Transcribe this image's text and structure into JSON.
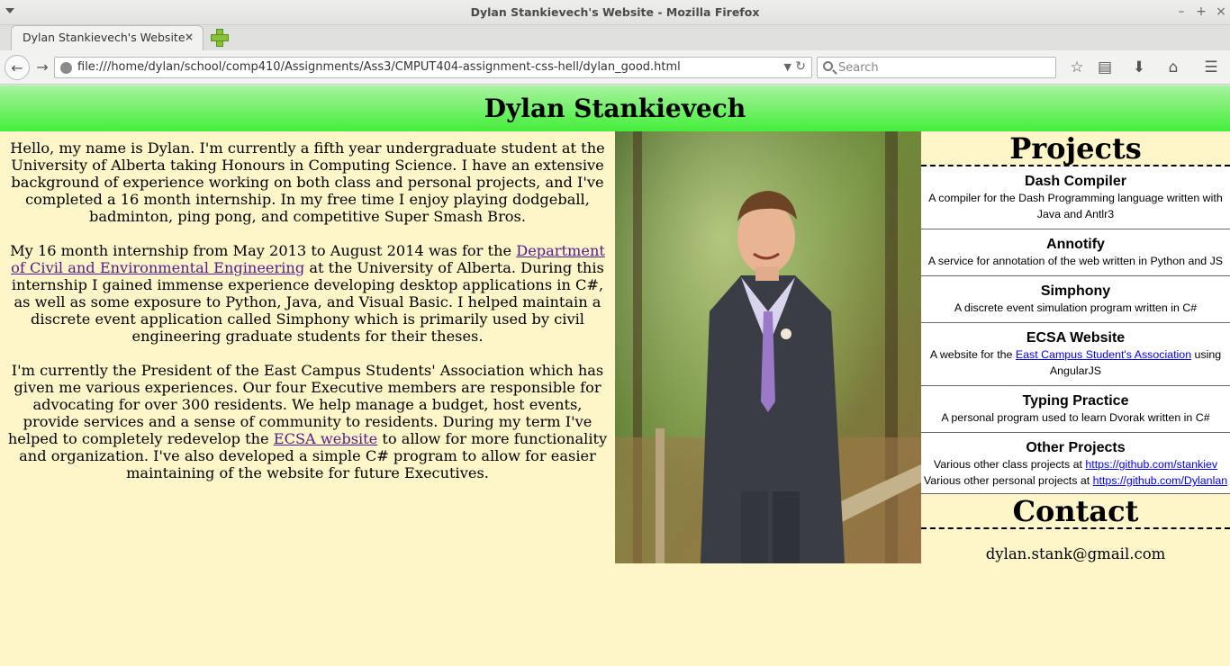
{
  "window": {
    "title": "Dylan Stankievech's Website - Mozilla Firefox",
    "controls": [
      "–",
      "+",
      "×"
    ]
  },
  "tab": {
    "label": "Dylan Stankievech's Website",
    "close": "×"
  },
  "nav": {
    "url": "file:///home/dylan/school/comp410/Assignments/Ass3/CMPUT404-assignment-css-hell/dylan_good.html",
    "search_placeholder": "Search"
  },
  "page": {
    "heading": "Dylan Stankievech",
    "bio": {
      "p1": "Hello, my name is Dylan. I'm currently a fifth year undergraduate student at the University of Alberta taking Honours in Computing Science. I have an extensive background of experience working on both class and personal projects, and I've completed a 16 month internship. In my free time I enjoy playing dodgeball, badminton, ping pong, and competitive Super Smash Bros.",
      "p2_before": "My 16 month internship from May 2013 to August 2014 was for the ",
      "p2_link": "Department of Civil and Environmental Engineering",
      "p2_after": " at the University of Alberta. During this internship I gained immense experience developing desktop applications in C#, as well as some exposure to Python, Java, and Visual Basic. I helped maintain a discrete event application called Simphony which is primarily used by civil engineering graduate students for their theses.",
      "p3_before": "I'm currently the President of the East Campus Students' Association which has given me various experiences. Our four Executive members are responsible for advocating for over 300 residents. We help manage a budget, host events, provide services and a sense of community to residents. During my term I've helped to completely redevelop the ",
      "p3_link": "ECSA website",
      "p3_after": " to allow for more functionality and organization. I've also developed a simple C# program to allow for easier maintaining of the website for future Executives."
    },
    "projects_heading": "Projects",
    "projects": [
      {
        "title": "Dash Compiler",
        "desc": "A compiler for the Dash Programming language written with Java and Antlr3"
      },
      {
        "title": "Annotify",
        "desc": "A service for annotation of the web written in Python and JS"
      },
      {
        "title": "Simphony",
        "desc": "A discrete event simulation program written in C#"
      },
      {
        "title": "ECSA Website",
        "desc_before": "A website for the ",
        "desc_link": "East Campus Student's Association",
        "desc_after": " using AngularJS"
      },
      {
        "title": "Typing Practice",
        "desc": "A personal program used to learn Dvorak written in C#"
      },
      {
        "title": "Other Projects",
        "line1_before": "Various other class projects at ",
        "line1_link": "https://github.com/stankiev",
        "line2_before": "Various other personal projects at ",
        "line2_link": "https://github.com/Dylanlan"
      }
    ],
    "contact_heading": "Contact",
    "email": "dylan.stank@gmail.com"
  },
  "colors": {
    "page_bg": "#fef6c8",
    "header_top": "#a8f2a0",
    "header_bottom": "#44ee3a",
    "visited_link": "#551a8b",
    "link": "#0000ee"
  }
}
